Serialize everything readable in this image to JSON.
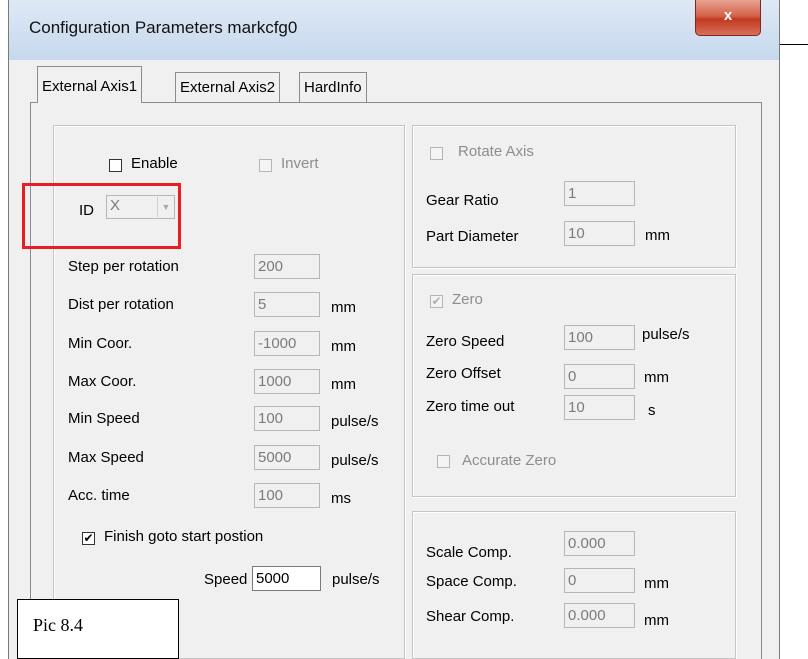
{
  "window": {
    "title": "Configuration Parameters markcfg0",
    "close_glyph": "x"
  },
  "tabs": [
    {
      "label": "External Axis1",
      "active": true
    },
    {
      "label": "External Axis2",
      "active": false
    },
    {
      "label": "HardInfo",
      "active": false
    }
  ],
  "axis": {
    "enable_label": "Enable",
    "enable_checked": false,
    "invert_label": "Invert",
    "invert_checked": false,
    "id_label": "ID",
    "id_value": "X",
    "params": [
      {
        "label": "Step per rotation",
        "value": "200",
        "unit": ""
      },
      {
        "label": "Dist per rotation",
        "value": "5",
        "unit": "mm"
      },
      {
        "label": "Min Coor.",
        "value": "-1000",
        "unit": "mm"
      },
      {
        "label": "Max Coor.",
        "value": "1000",
        "unit": "mm"
      },
      {
        "label": "Min Speed",
        "value": "100",
        "unit": "pulse/s"
      },
      {
        "label": "Max Speed",
        "value": "5000",
        "unit": "pulse/s"
      },
      {
        "label": "Acc. time",
        "value": "100",
        "unit": "ms"
      }
    ],
    "finish_label": "Finish goto start postion",
    "finish_checked": true,
    "speed_label": "Speed",
    "speed_value": "5000",
    "speed_unit": "pulse/s"
  },
  "rotate": {
    "rotate_label": "Rotate Axis",
    "rotate_checked": false,
    "gear_label": "Gear Ratio",
    "gear_value": "1",
    "diameter_label": "Part Diameter",
    "diameter_value": "10",
    "diameter_unit": "mm"
  },
  "zero": {
    "zero_label": "Zero",
    "zero_checked": true,
    "speed_label": "Zero Speed",
    "speed_value": "100",
    "speed_unit": "pulse/s",
    "offset_label": "Zero Offset",
    "offset_value": "0",
    "offset_unit": "mm",
    "timeout_label": "Zero time out",
    "timeout_value": "10",
    "timeout_unit": "s",
    "accurate_label": "Accurate Zero",
    "accurate_checked": false
  },
  "comp": {
    "scale_label": "Scale Comp.",
    "scale_value": "0.000",
    "space_label": "Space Comp.",
    "space_value": "0",
    "space_unit": "mm",
    "shear_label": "Shear Comp.",
    "shear_value": "0.000",
    "shear_unit": "mm"
  },
  "check_mark": "✔",
  "dropdown_glyph": "▼",
  "caption": "Pic 8.4",
  "colors": {
    "highlight_box": "#ea1c24",
    "close_button": "#c23a20",
    "titlebar": "#d3e1f1"
  }
}
